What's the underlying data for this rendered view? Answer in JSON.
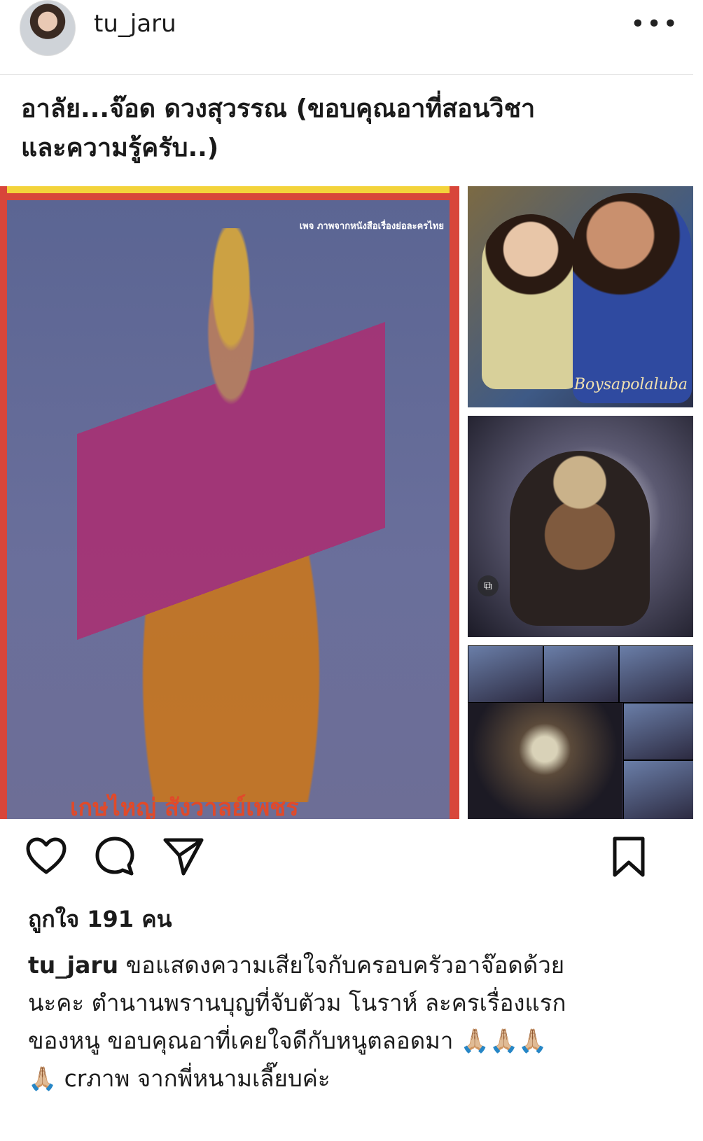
{
  "header": {
    "username": "tu_jaru",
    "more_label": "•••"
  },
  "post": {
    "title": "อาลัย...จ๊อด ดวงสุวรรณ (ขอบคุณอาที่สอนวิชา\nและความรู้ครับ..)",
    "main_photo": {
      "caption_top": "เพจ ภาพจากหนังสือเรื่องย่อละครไทย",
      "caption_bottom": "เกษไหญ่ สังวาลย์เพชร"
    },
    "side_photo_1": {
      "watermark": "Boysapolaluba"
    },
    "expand_icon": "⧉"
  },
  "actions": {
    "like_icon": "heart-icon",
    "comment_icon": "comment-icon",
    "share_icon": "send-icon",
    "save_icon": "bookmark-icon"
  },
  "likes_text": "ถูกใจ 191 คน",
  "caption": {
    "user": "tu_jaru",
    "text": "ขอแสดงความเสียใจกับครอบครัวอาจ๊อดด้วย\nนะคะ ตำนานพรานบุญที่จับตัวม โนราห์ ละครเรื่องแรก\nของหนู ขอบคุณอาที่เคยใจดีกับหนูตลอดมา 🙏🏼🙏🏼🙏🏼\n🙏🏼 crภาพ จากพี่หนามเลี๊ยบค่ะ"
  }
}
